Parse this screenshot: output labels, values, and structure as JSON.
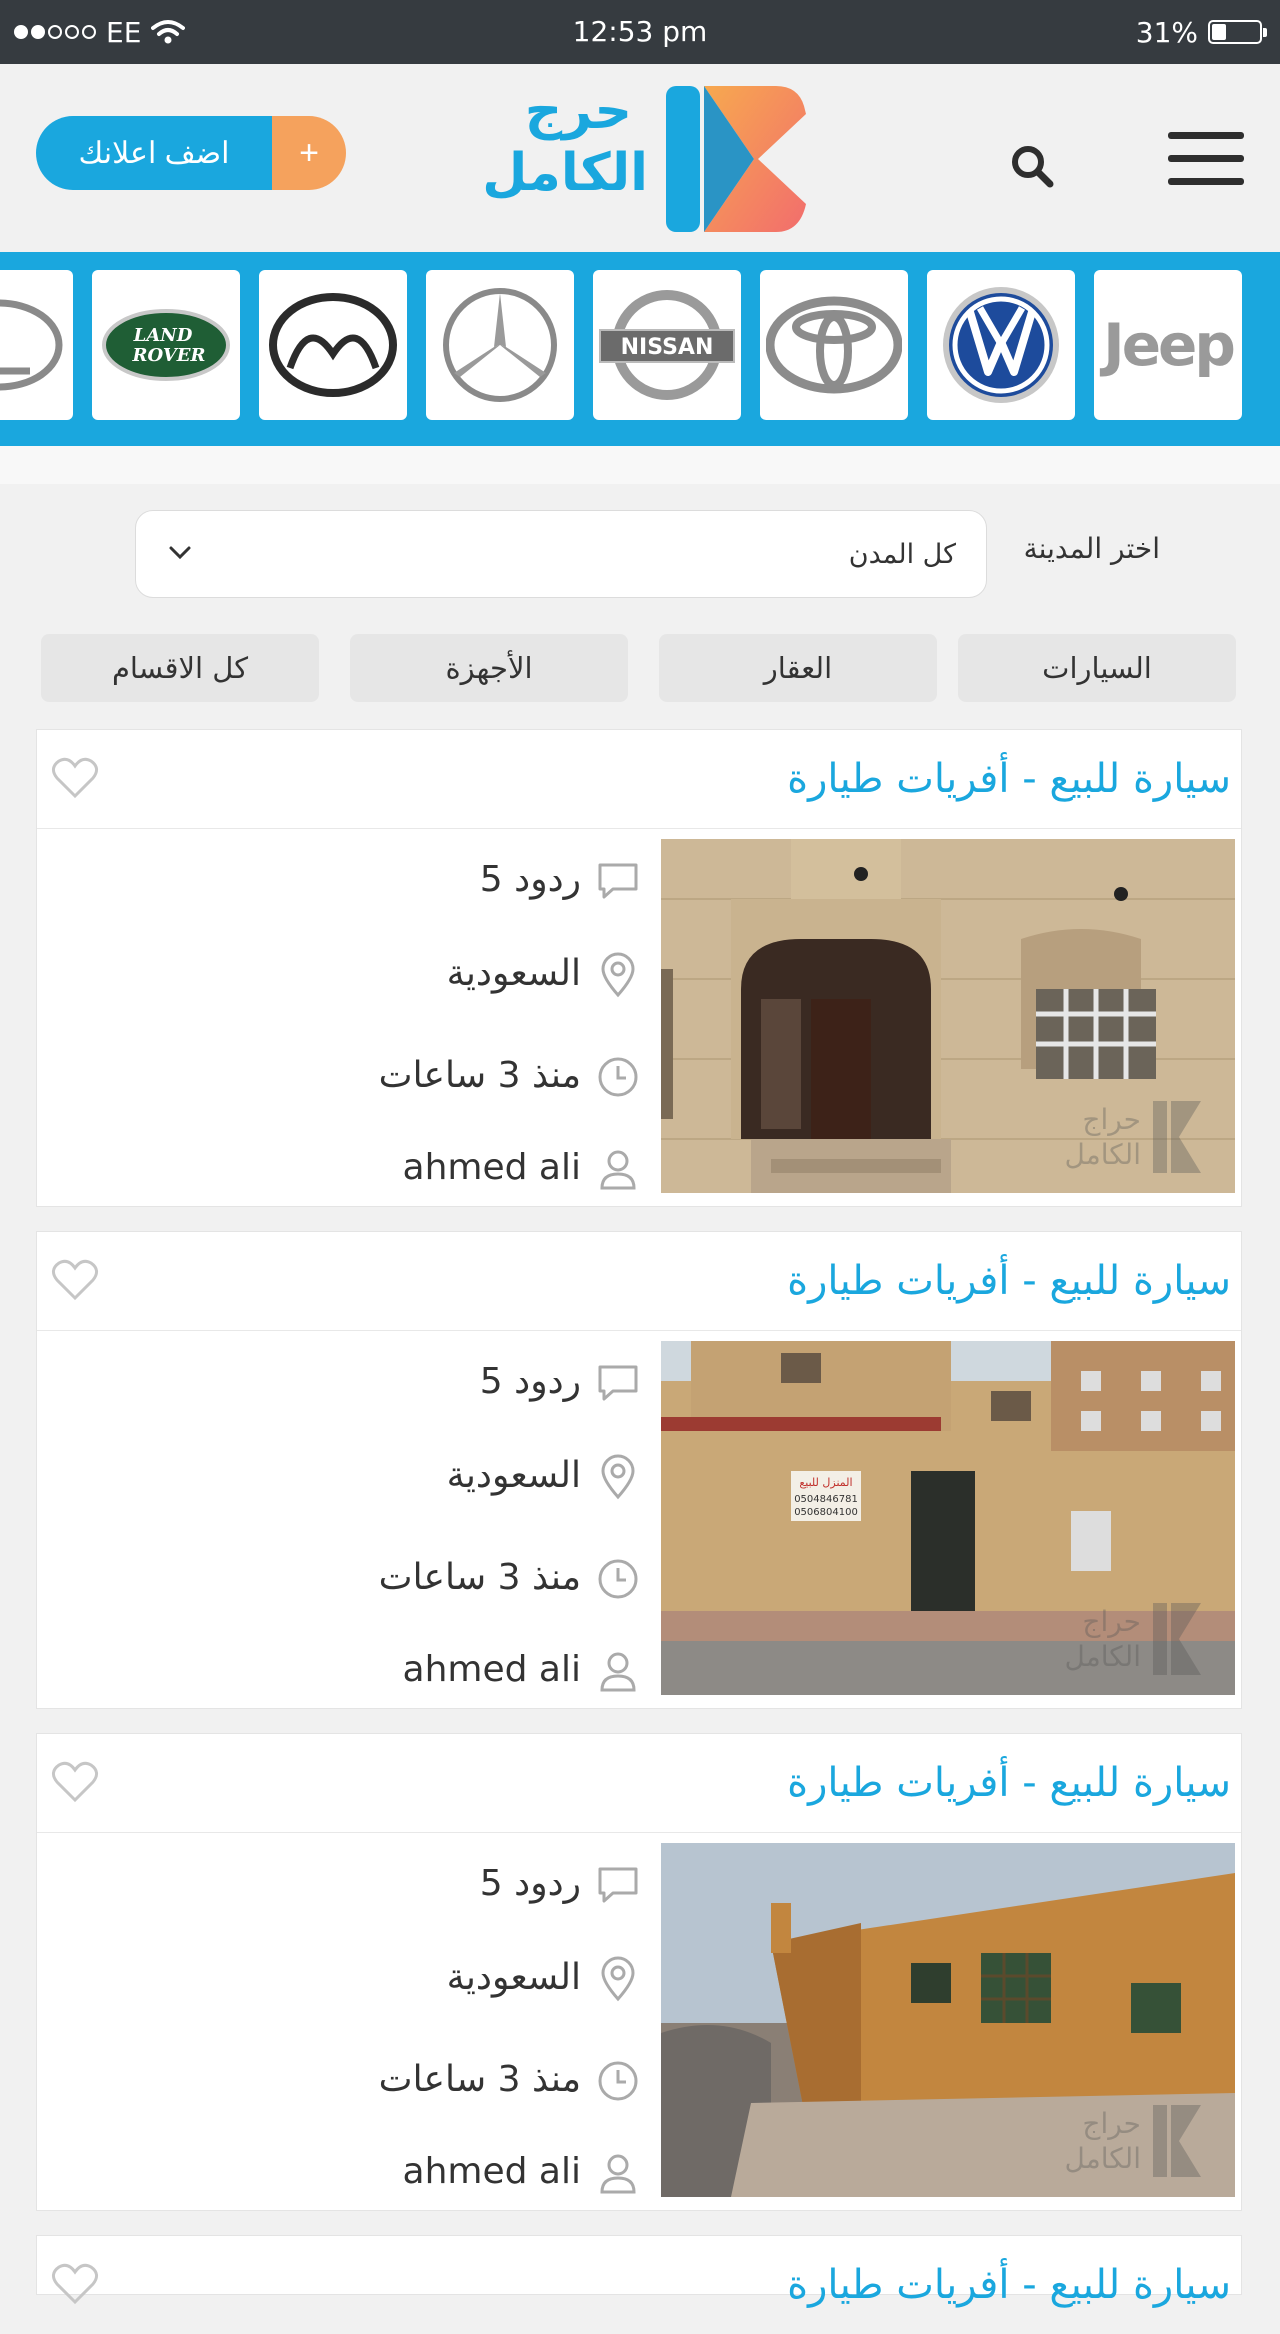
{
  "status_bar": {
    "carrier": "EE",
    "time": "12:53 pm",
    "battery": "31%",
    "battery_level": 0.31
  },
  "header": {
    "add_button_label": "اضف اعلانك",
    "add_button_plus": "+",
    "logo_line1": "حرج",
    "logo_line2": "الكامل"
  },
  "brands": [
    {
      "name": "Jeep",
      "icon": "jeep-logo"
    },
    {
      "name": "Volkswagen",
      "icon": "vw-logo"
    },
    {
      "name": "Toyota",
      "icon": "toyota-logo"
    },
    {
      "name": "Nissan",
      "icon": "nissan-logo",
      "text": "NISSAN"
    },
    {
      "name": "Mercedes",
      "icon": "mercedes-logo"
    },
    {
      "name": "Mazda",
      "icon": "mazda-logo"
    },
    {
      "name": "Land Rover",
      "icon": "land-rover-logo",
      "text1": "LAND",
      "text2": "ROVER"
    },
    {
      "name": "Lexus",
      "icon": "lexus-logo"
    }
  ],
  "filter": {
    "city_label": "اختر المدينة",
    "city_value": "كل المدن"
  },
  "categories": [
    "السيارات",
    "العقار",
    "الأجهزة",
    "كل الاقسام"
  ],
  "listings": [
    {
      "title": "سيارة للبيع - أفريات طيارة",
      "replies": "5 ردود",
      "location": "السعودية",
      "time": "منذ 3 ساعات",
      "user": "ahmed ali"
    },
    {
      "title": "سيارة للبيع - أفريات طيارة",
      "replies": "5 ردود",
      "location": "السعودية",
      "time": "منذ 3 ساعات",
      "user": "ahmed ali",
      "sign": "المنزل للبيع",
      "phone1": "0504846781",
      "phone2": "0506804100"
    },
    {
      "title": "سيارة للبيع - أفريات طيارة",
      "replies": "5 ردود",
      "location": "السعودية",
      "time": "منذ 3 ساعات",
      "user": "ahmed ali"
    },
    {
      "title": "سيارة للبيع - أفريات طيارة"
    }
  ],
  "watermark": {
    "line1": "حراج",
    "line2": "الكامل"
  },
  "colors": {
    "accent": "#1aa7de",
    "orange": "#f5a25d",
    "status_bar": "#363b40"
  }
}
